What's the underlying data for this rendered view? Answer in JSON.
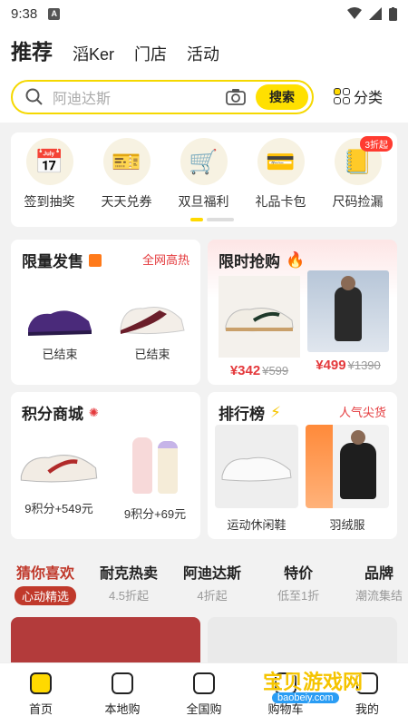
{
  "status": {
    "time": "9:38",
    "a_badge": "A"
  },
  "header": {
    "tabs": [
      "推荐",
      "滔Ker",
      "门店",
      "活动"
    ],
    "search_placeholder": "阿迪达斯",
    "search_button": "搜索",
    "category_label": "分类"
  },
  "quick_icons": [
    {
      "label": "签到抽奖",
      "icon": "calendar-icon",
      "glyph": "📅"
    },
    {
      "label": "天天兑券",
      "icon": "coupon-icon",
      "glyph": "🎫"
    },
    {
      "label": "双旦福利",
      "icon": "cart-icon",
      "glyph": "🛒"
    },
    {
      "label": "礼品卡包",
      "icon": "gift-card-icon",
      "glyph": "💳"
    },
    {
      "label": "尺码捡漏",
      "icon": "notebook-icon",
      "glyph": "📒",
      "badge": "3折起"
    }
  ],
  "limited": {
    "title": "限量发售",
    "sub": "全网高热",
    "items": [
      {
        "label": "已结束"
      },
      {
        "label": "已结束"
      }
    ]
  },
  "flash": {
    "title": "限时抢购",
    "items": [
      {
        "price": "¥342",
        "orig": "¥599"
      },
      {
        "price": "¥499",
        "orig": "¥1390"
      }
    ]
  },
  "points": {
    "title": "积分商城",
    "items": [
      {
        "label": "9积分+549元"
      },
      {
        "label": "9积分+69元"
      }
    ]
  },
  "ranking": {
    "title": "排行榜",
    "sub": "人气尖货",
    "items": [
      {
        "label": "运动休闲鞋"
      },
      {
        "label": "羽绒服"
      }
    ]
  },
  "reco_tabs": [
    {
      "title": "猜你喜欢",
      "sub": "心动精选"
    },
    {
      "title": "耐克热卖",
      "sub": "4.5折起"
    },
    {
      "title": "阿迪达斯",
      "sub": "4折起"
    },
    {
      "title": "特价",
      "sub": "低至1折"
    },
    {
      "title": "品牌",
      "sub": "潮流集结"
    }
  ],
  "nav": [
    "首页",
    "本地购",
    "全国购",
    "购物车",
    "我的"
  ],
  "watermark": {
    "text": "宝贝游戏网",
    "url": "baobeiy.com"
  },
  "colors": {
    "accent": "#ffd900",
    "red": "#e4393c"
  }
}
